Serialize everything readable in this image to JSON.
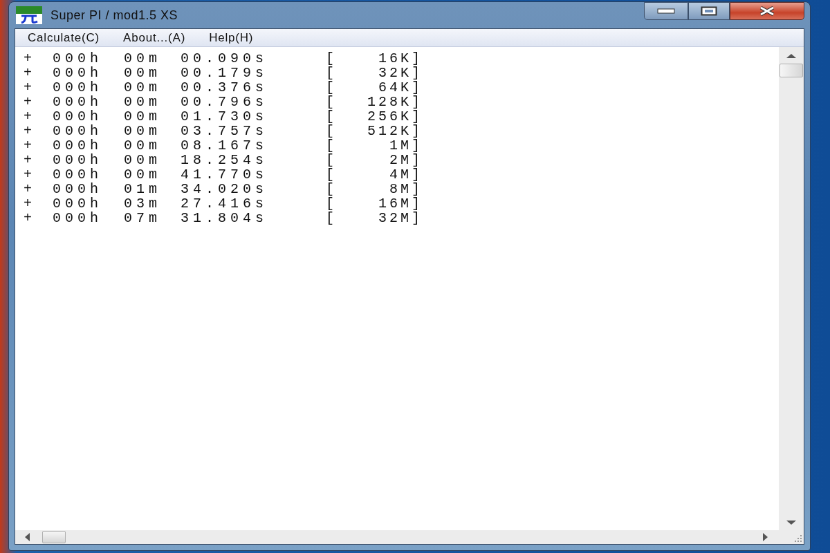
{
  "window": {
    "title": "Super PI / mod1.5 XS"
  },
  "menu": [
    "Calculate(C)",
    "About...(A)",
    "Help(H)"
  ],
  "log_rows": [
    {
      "sign": "+",
      "hours": "000h",
      "minutes": "00m",
      "seconds": "00.090s",
      "bracket": "[",
      "size": "16K]"
    },
    {
      "sign": "+",
      "hours": "000h",
      "minutes": "00m",
      "seconds": "00.179s",
      "bracket": "[",
      "size": "32K]"
    },
    {
      "sign": "+",
      "hours": "000h",
      "minutes": "00m",
      "seconds": "00.376s",
      "bracket": "[",
      "size": "64K]"
    },
    {
      "sign": "+",
      "hours": "000h",
      "minutes": "00m",
      "seconds": "00.796s",
      "bracket": "[",
      "size": "128K]"
    },
    {
      "sign": "+",
      "hours": "000h",
      "minutes": "00m",
      "seconds": "01.730s",
      "bracket": "[",
      "size": "256K]"
    },
    {
      "sign": "+",
      "hours": "000h",
      "minutes": "00m",
      "seconds": "03.757s",
      "bracket": "[",
      "size": "512K]"
    },
    {
      "sign": "+",
      "hours": "000h",
      "minutes": "00m",
      "seconds": "08.167s",
      "bracket": "[",
      "size": "1M]"
    },
    {
      "sign": "+",
      "hours": "000h",
      "minutes": "00m",
      "seconds": "18.254s",
      "bracket": "[",
      "size": "2M]"
    },
    {
      "sign": "+",
      "hours": "000h",
      "minutes": "00m",
      "seconds": "41.770s",
      "bracket": "[",
      "size": "4M]"
    },
    {
      "sign": "+",
      "hours": "000h",
      "minutes": "01m",
      "seconds": "34.020s",
      "bracket": "[",
      "size": "8M]"
    },
    {
      "sign": "+",
      "hours": "000h",
      "minutes": "03m",
      "seconds": "27.416s",
      "bracket": "[",
      "size": "16M]"
    },
    {
      "sign": "+",
      "hours": "000h",
      "minutes": "07m",
      "seconds": "31.804s",
      "bracket": "[",
      "size": "32M]"
    }
  ]
}
